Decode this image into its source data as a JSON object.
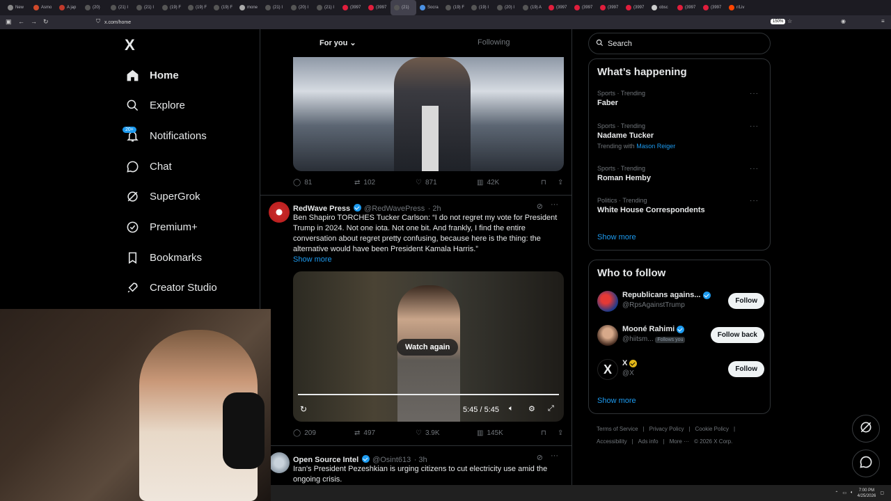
{
  "browser": {
    "tabs": [
      "New",
      "Asmo",
      "A jap",
      "(20)",
      "(21) I",
      "(21) I",
      "(19) F",
      "(19) F",
      "(19) F",
      "mone",
      "(21) I",
      "(20) I",
      "(21) I",
      "(3997",
      "(3997",
      "(21)",
      "Socra",
      "(19) F",
      "(19) I",
      "(20) I",
      "(19) A",
      "(3997",
      "(3997",
      "(3997",
      "(3997",
      "obsc",
      "(3997",
      "(3997",
      "r/Liv"
    ],
    "url": "x.com/home",
    "zoom": "150%"
  },
  "sidebar": {
    "logo": "X",
    "items": [
      {
        "label": "Home"
      },
      {
        "label": "Explore"
      },
      {
        "label": "Notifications",
        "badge": "20+"
      },
      {
        "label": "Chat"
      },
      {
        "label": "SuperGrok"
      },
      {
        "label": "Premium+"
      },
      {
        "label": "Bookmarks"
      },
      {
        "label": "Creator Studio"
      }
    ]
  },
  "timeline": {
    "tabs": {
      "for_you": "For you",
      "following": "Following"
    },
    "post1_stats": {
      "replies": "81",
      "reposts": "102",
      "likes": "871",
      "views": "42K"
    },
    "post2": {
      "name": "RedWave Press",
      "handle": "@RedWavePress",
      "time": "· 2h",
      "text": "Ben Shapiro TORCHES Tucker Carlson: “I do not regret my vote for President Trump in 2024. Not one iota. Not one bit. And frankly, I find the entire conversation about regret pretty confusing, because here is the thing: the alternative would have been President Kamala Harris.”",
      "show_more": "Show more",
      "video": {
        "overlay": "Watch again",
        "time": "5:45 / 5:45"
      },
      "stats": {
        "replies": "209",
        "reposts": "497",
        "likes": "3.9K",
        "views": "145K"
      }
    },
    "post3": {
      "name": "Open Source Intel",
      "handle": "@Osint613",
      "time": "· 3h",
      "text": "Iran's President Pezeshkian is urging citizens to cut electricity use amid the ongoing crisis."
    }
  },
  "right": {
    "search_placeholder": "Search",
    "happening": {
      "title": "What’s happening",
      "trends": [
        {
          "meta": "Sports · Trending",
          "title": "Faber",
          "sub": ""
        },
        {
          "meta": "Sports · Trending",
          "title": "Nadame Tucker",
          "sub": "Trending with",
          "sub_link": "Mason Reiger"
        },
        {
          "meta": "Sports · Trending",
          "title": "Roman Hemby",
          "sub": ""
        },
        {
          "meta": "Politics · Trending",
          "title": "White House Correspondents",
          "sub": ""
        }
      ],
      "show_more": "Show more"
    },
    "who_to_follow": {
      "title": "Who to follow",
      "accounts": [
        {
          "name": "Republicans agains...",
          "handle": "@RpsAgainstTrump",
          "button": "Follow"
        },
        {
          "name": "Mooné Rahimi",
          "handle": "@hiitsm...",
          "follows_you": "Follows you",
          "button": "Follow back"
        },
        {
          "name": "X",
          "handle": "@X",
          "button": "Follow"
        }
      ],
      "show_more": "Show more"
    },
    "footer": {
      "line1": [
        "Terms of Service",
        "|",
        "Privacy Policy",
        "|",
        "Cookie Policy",
        "|"
      ],
      "line2": [
        "Accessibility",
        "|",
        "Ads info",
        "|",
        "More ···",
        "© 2026 X Corp."
      ]
    }
  },
  "taskbar": {
    "time": "7:00 PM",
    "date": "4/25/2026"
  },
  "colors": {
    "accent": "#1d9bf0",
    "background": "#000000",
    "border": "#2f3336",
    "muted": "#71767b"
  }
}
